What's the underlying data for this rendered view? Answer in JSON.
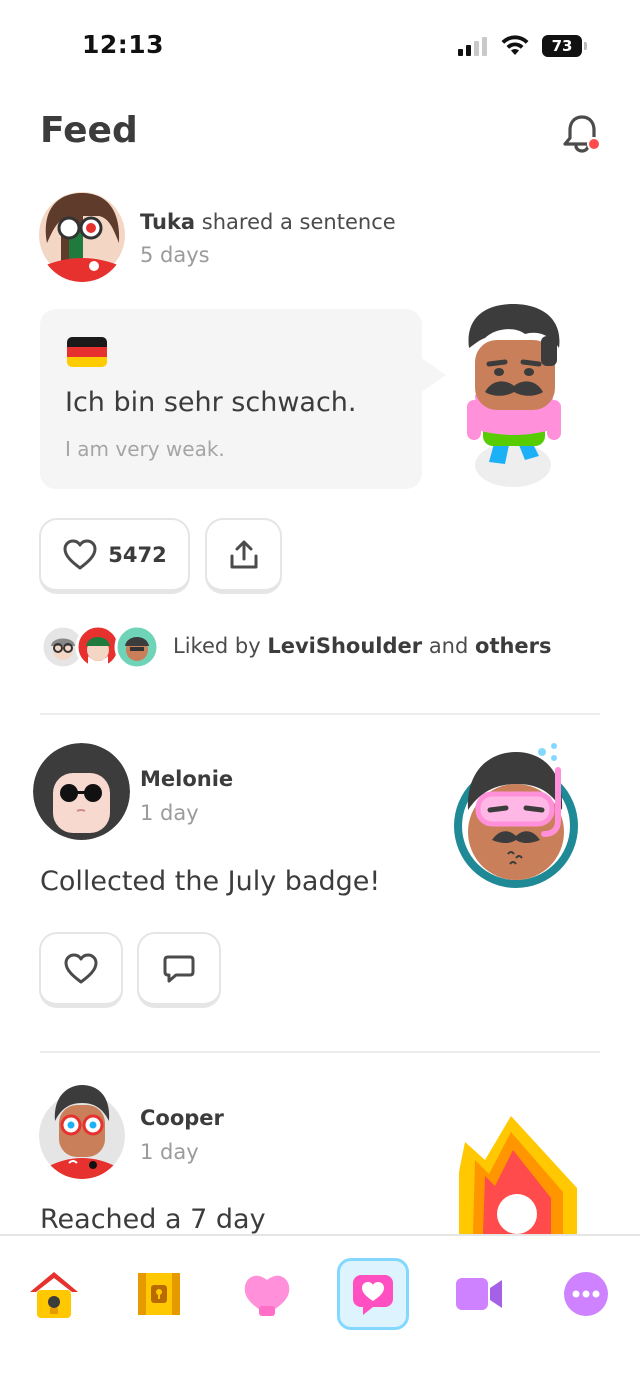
{
  "status": {
    "time": "12:13",
    "battery": "73"
  },
  "header": {
    "title": "Feed"
  },
  "posts": [
    {
      "user": "Tuka",
      "action": "shared a sentence",
      "time": "5 days",
      "sentence": "Ich bin sehr schwach.",
      "translation": "I am very weak.",
      "like_count": "5472",
      "liked_by_prefix": "Liked by",
      "liked_by_user": "LeviShoulder",
      "liked_by_and": "and",
      "liked_by_others": "others"
    },
    {
      "user": "Melonie",
      "time": "1 day",
      "text": "Collected the July badge!"
    },
    {
      "user": "Cooper",
      "time": "1 day",
      "text": "Reached a 7 day"
    }
  ],
  "colors": {
    "accent_blue": "#1cb0f6",
    "flag_black": "#1a1a1a",
    "flag_red": "#e6312e",
    "flag_gold": "#ffcc00",
    "notification_dot": "#ff4b4b"
  },
  "tabs": [
    {
      "name": "home-icon",
      "active": false
    },
    {
      "name": "treasure-chest-icon",
      "active": false
    },
    {
      "name": "shell-icon",
      "active": false
    },
    {
      "name": "feed-heart-icon",
      "active": true
    },
    {
      "name": "video-camera-icon",
      "active": false
    },
    {
      "name": "more-icon",
      "active": false
    }
  ]
}
